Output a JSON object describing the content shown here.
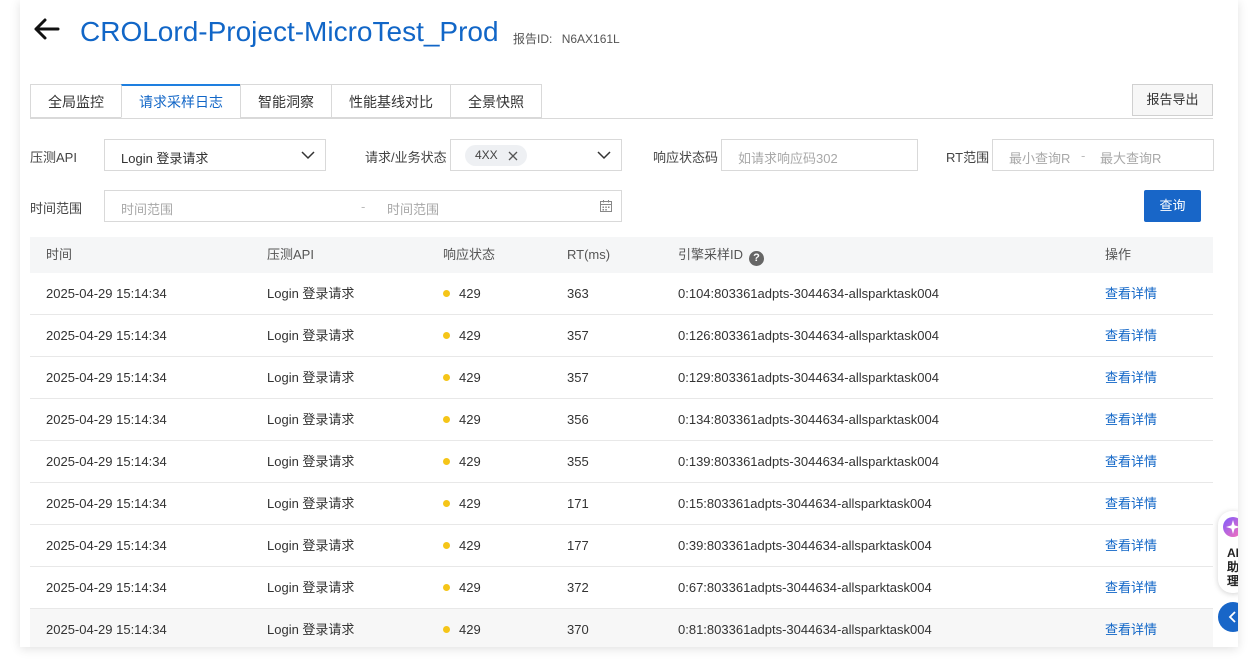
{
  "header": {
    "title": "CROLord-Project-MicroTest_Prod",
    "report_id_label": "报告ID:",
    "report_id": "N6AX161L"
  },
  "tabs": [
    {
      "label": "全局监控"
    },
    {
      "label": "请求采样日志",
      "active": true
    },
    {
      "label": "智能洞察"
    },
    {
      "label": "性能基线对比"
    },
    {
      "label": "全景快照"
    }
  ],
  "export_label": "报告导出",
  "filters": {
    "api_label": "压测API",
    "api_value": "Login 登录请求",
    "status_label": "请求/业务状态",
    "status_tag": "4XX",
    "code_label": "响应状态码",
    "code_placeholder": "如请求响应码302",
    "rt_label": "RT范围",
    "rt_min_placeholder": "最小查询R",
    "rt_max_placeholder": "最大查询R",
    "time_label": "时间范围",
    "time_start_placeholder": "时间范围",
    "time_end_placeholder": "时间范围",
    "query_label": "查询"
  },
  "table": {
    "columns": [
      "时间",
      "压测API",
      "响应状态",
      "RT(ms)",
      "引擎采样ID",
      "操作"
    ],
    "rows": [
      {
        "time": "2025-04-29 15:14:34",
        "api": "Login 登录请求",
        "status": "429",
        "rt": "363",
        "id": "0:104:803361adpts-3044634-allsparktask004",
        "action": "查看详情"
      },
      {
        "time": "2025-04-29 15:14:34",
        "api": "Login 登录请求",
        "status": "429",
        "rt": "357",
        "id": "0:126:803361adpts-3044634-allsparktask004",
        "action": "查看详情"
      },
      {
        "time": "2025-04-29 15:14:34",
        "api": "Login 登录请求",
        "status": "429",
        "rt": "357",
        "id": "0:129:803361adpts-3044634-allsparktask004",
        "action": "查看详情"
      },
      {
        "time": "2025-04-29 15:14:34",
        "api": "Login 登录请求",
        "status": "429",
        "rt": "356",
        "id": "0:134:803361adpts-3044634-allsparktask004",
        "action": "查看详情"
      },
      {
        "time": "2025-04-29 15:14:34",
        "api": "Login 登录请求",
        "status": "429",
        "rt": "355",
        "id": "0:139:803361adpts-3044634-allsparktask004",
        "action": "查看详情"
      },
      {
        "time": "2025-04-29 15:14:34",
        "api": "Login 登录请求",
        "status": "429",
        "rt": "171",
        "id": "0:15:803361adpts-3044634-allsparktask004",
        "action": "查看详情"
      },
      {
        "time": "2025-04-29 15:14:34",
        "api": "Login 登录请求",
        "status": "429",
        "rt": "177",
        "id": "0:39:803361adpts-3044634-allsparktask004",
        "action": "查看详情"
      },
      {
        "time": "2025-04-29 15:14:34",
        "api": "Login 登录请求",
        "status": "429",
        "rt": "372",
        "id": "0:67:803361adpts-3044634-allsparktask004",
        "action": "查看详情"
      },
      {
        "time": "2025-04-29 15:14:34",
        "api": "Login 登录请求",
        "status": "429",
        "rt": "370",
        "id": "0:81:803361adpts-3044634-allsparktask004",
        "action": "查看详情"
      }
    ]
  },
  "ai_assistant": {
    "chars": [
      "AI",
      "助",
      "理"
    ]
  },
  "colors": {
    "accent": "#1166c7",
    "primary_button": "#1866c8",
    "status_warning": "#f5c518"
  },
  "icons": [
    "back-arrow-icon",
    "chevron-down-icon",
    "close-icon",
    "calendar-icon",
    "question-icon",
    "sparkle-icon",
    "chevron-left-icon"
  ]
}
